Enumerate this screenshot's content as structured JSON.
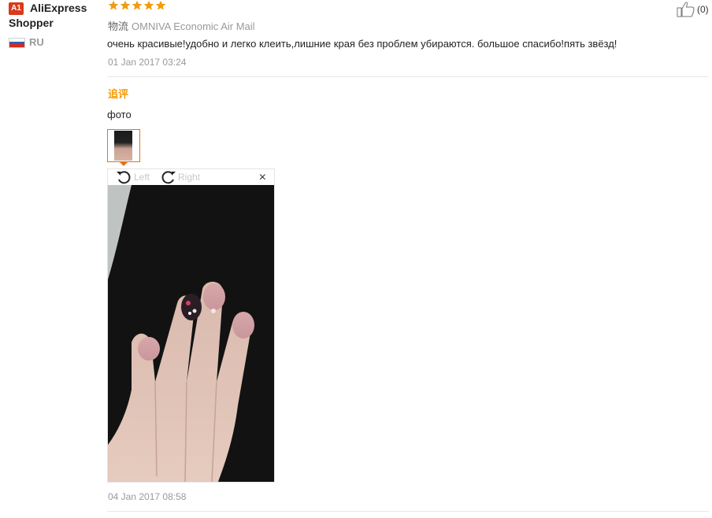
{
  "reviewer": {
    "level_badge": "A1",
    "name": "AliExpress Shopper",
    "country": "RU",
    "flag_icon": "russia-flag-icon"
  },
  "review": {
    "rating": 5,
    "star_color": "#f29b0b",
    "logistics_label": "物流",
    "logistics_value": "OMNIVA Economic Air Mail",
    "text": "очень красивые!удобно и легко клеить,лишние края без проблем убираются. большое спасибо!пять звёзд!",
    "date": "01 Jan 2017 03:24",
    "helpful_count": "(0)"
  },
  "followup": {
    "label": "追评",
    "label_color": "#f29b0b",
    "text": "фото",
    "date": "04 Jan 2017 08:58"
  },
  "viewer": {
    "rotate_left_label": "Left",
    "rotate_right_label": "Right",
    "close_label": "×"
  }
}
